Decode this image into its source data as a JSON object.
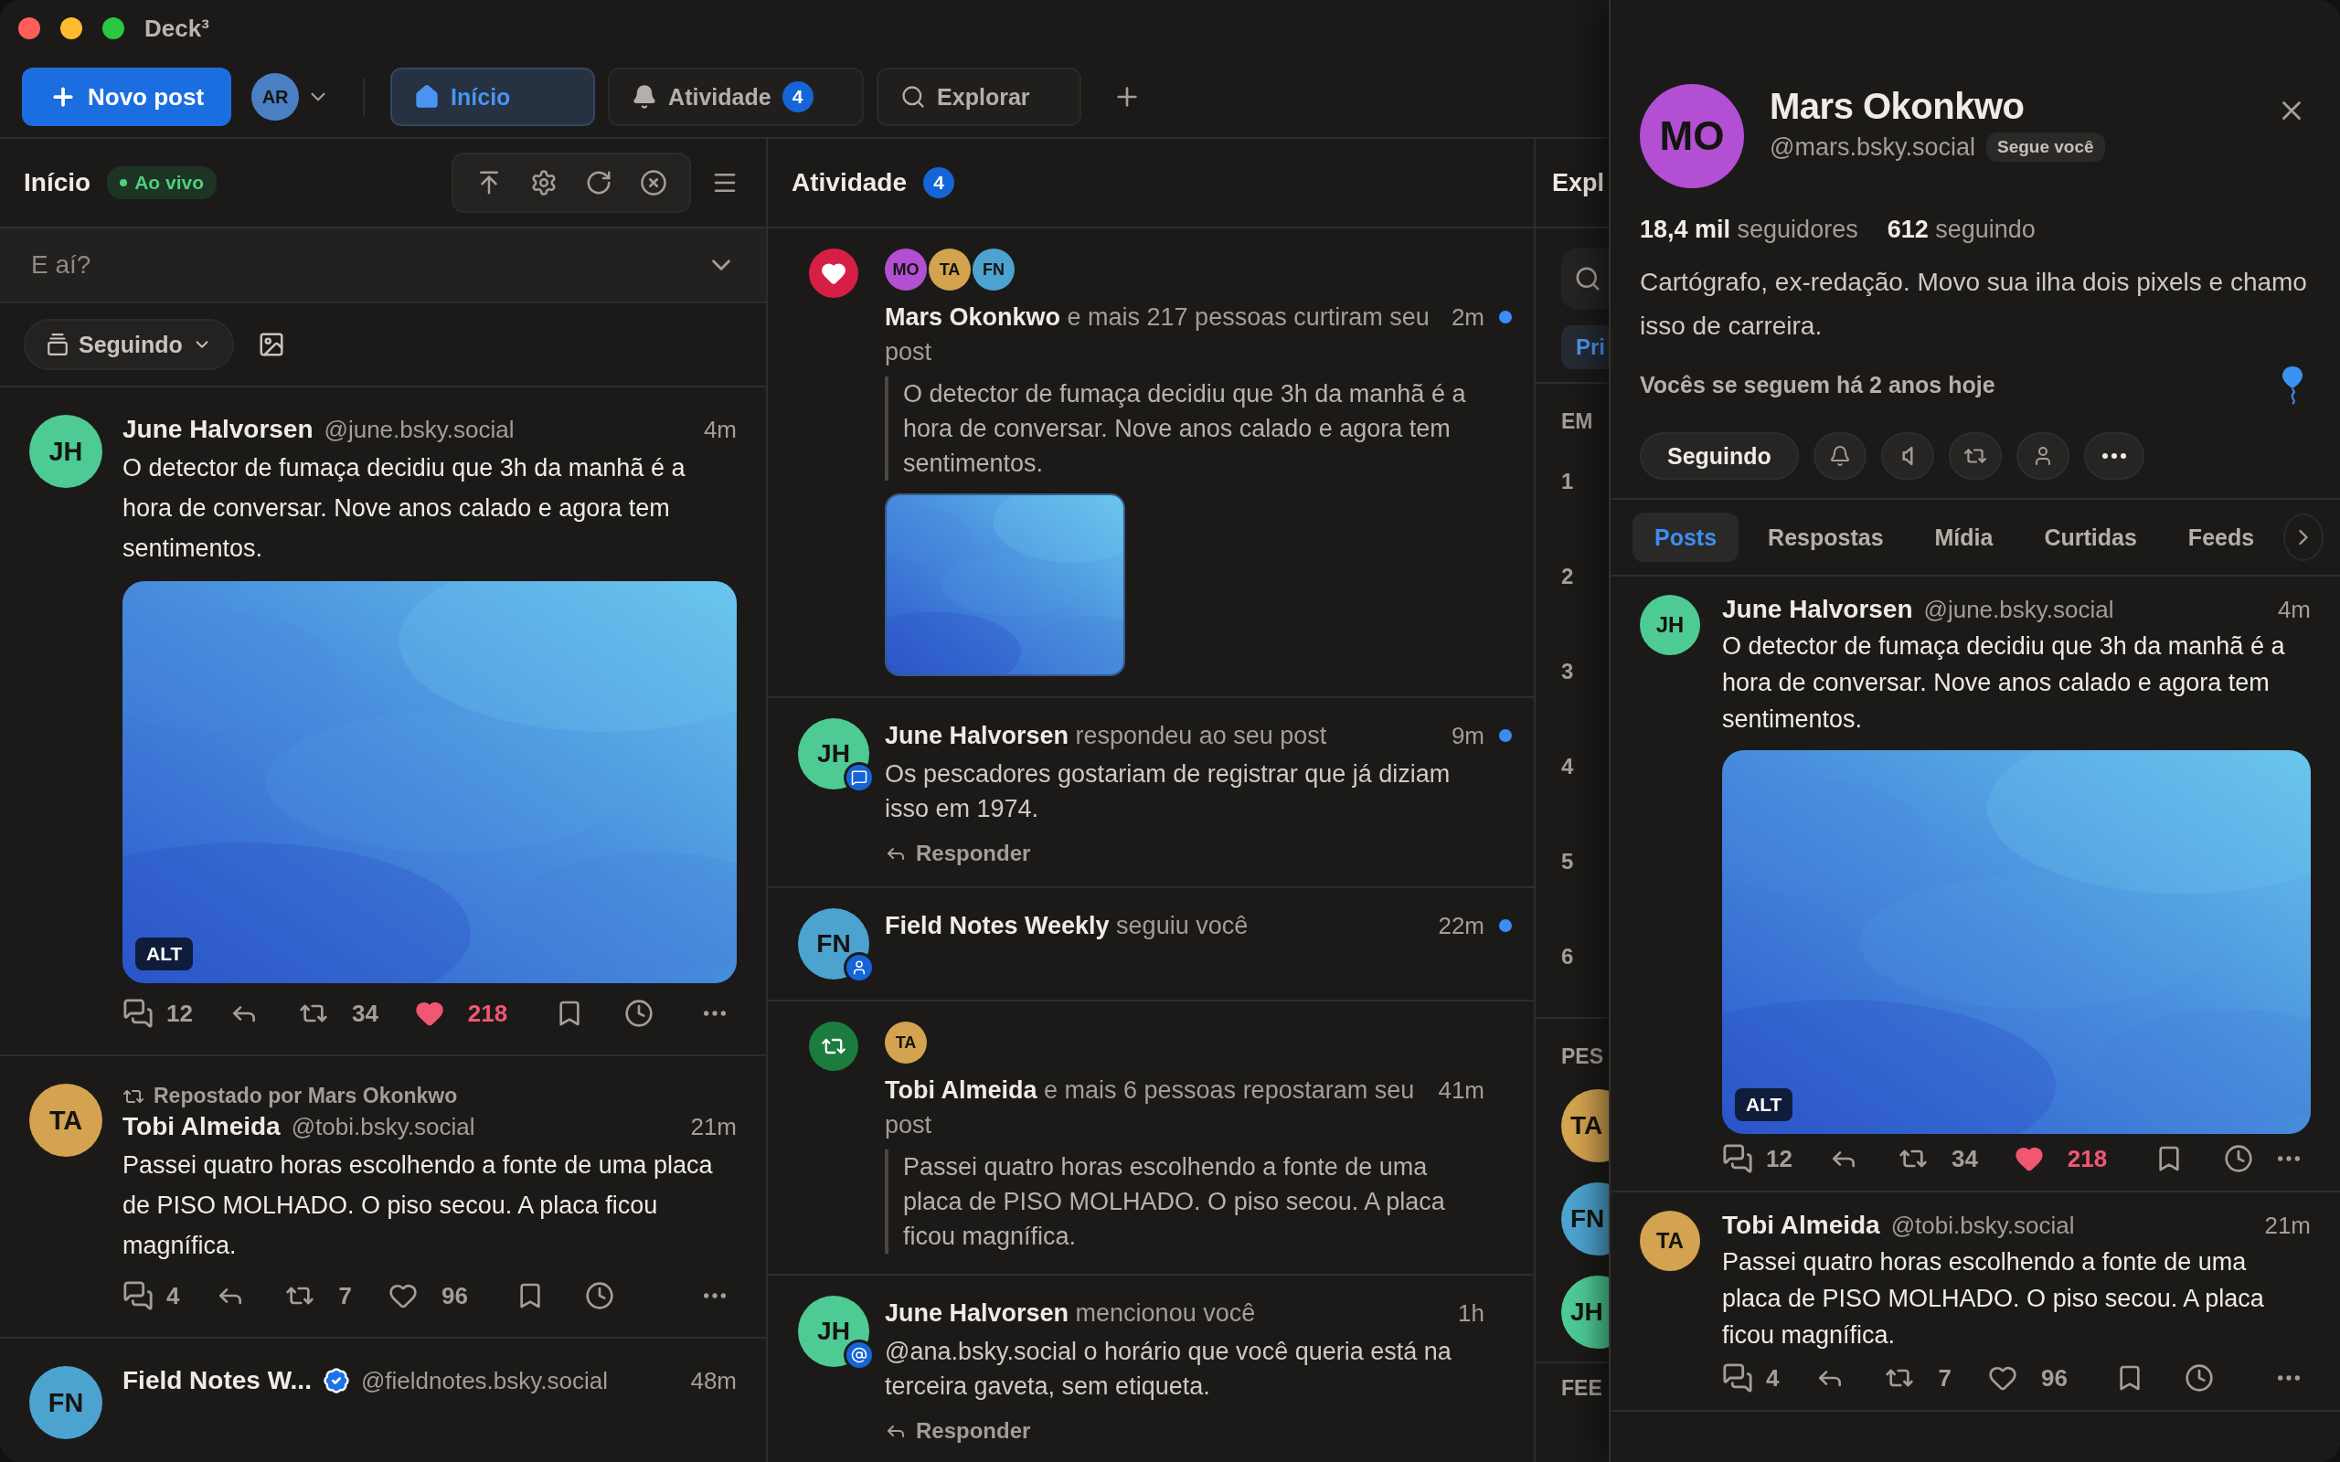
{
  "window": {
    "title": "Deck³"
  },
  "toolbar": {
    "new_post": "Novo post",
    "account": {
      "initials": "AR",
      "color": "#4a7fc4"
    },
    "tabs": [
      {
        "label": "Início",
        "selected": true
      },
      {
        "label": "Atividade",
        "badge": "4",
        "selected": false
      },
      {
        "label": "Explorar",
        "selected": false
      }
    ]
  },
  "home": {
    "title": "Início",
    "live_badge": "Ao vivo",
    "composer": {
      "placeholder": "E aí?"
    },
    "feed_filter": "Seguindo",
    "posts": [
      {
        "author": "June Halvorsen",
        "verified": false,
        "handle": "@june.bsky.social",
        "time": "4m",
        "avatar": {
          "initials": "JH",
          "color": "#4ecb94"
        },
        "text": "O detector de fumaça decidiu que 3h da manhã é a hora de conversar. Nove anos calado e agora tem sentimentos.",
        "image": {
          "kind": "picture",
          "alt_badge": "ALT"
        },
        "replies": "12",
        "reposts": "34",
        "likes": "218",
        "liked": true
      },
      {
        "reposted_by": "Repostado por Mars Okonkwo",
        "author": "Tobi Almeida",
        "verified": false,
        "handle": "@tobi.bsky.social",
        "time": "21m",
        "avatar": {
          "initials": "TA",
          "color": "#d3a34f"
        },
        "text": "Passei quatro horas escolhendo a fonte de uma placa de PISO MOLHADO. O piso secou. A placa ficou magnífica.",
        "replies": "4",
        "reposts": "7",
        "likes": "96",
        "liked": false
      },
      {
        "author": "Field Notes W...",
        "verified": true,
        "handle": "@fieldnotes.bsky.social",
        "time": "48m",
        "avatar": {
          "initials": "FN",
          "color": "#4ca3cf"
        }
      }
    ]
  },
  "activity": {
    "title": "Atividade",
    "badge": "4",
    "notifications": [
      {
        "kind": "like",
        "unread": true,
        "avatars": [
          {
            "initials": "MO",
            "color": "#b24fd2"
          },
          {
            "initials": "TA",
            "color": "#d3a34f"
          },
          {
            "initials": "FN",
            "color": "#4ca3cf"
          }
        ],
        "headline": "**Mars Okonkwo** e mais 217 pessoas curtiram seu post",
        "time": "2m",
        "quote": "O detector de fumaça decidiu que 3h da manhã é a hora de conversar. Nove anos calado e agora tem sentimentos."
      },
      {
        "kind": "reply",
        "unread": true,
        "avatar": {
          "initials": "JH",
          "color": "#4ecb94"
        },
        "headline": "**June Halvorsen** respondeu ao seu post",
        "time": "9m",
        "text": "Os pescadores gostariam de registrar que já diziam isso em 1974.",
        "reply_label": "Responder"
      },
      {
        "kind": "follow",
        "unread": true,
        "avatar": {
          "initials": "FN",
          "color": "#4ca3cf"
        },
        "headline": "**Field Notes Weekly** seguiu você",
        "time": "22m"
      },
      {
        "kind": "repost",
        "unread": false,
        "avatars": [
          {
            "initials": "TA",
            "color": "#d3a34f"
          }
        ],
        "headline": "**Tobi Almeida** e mais 6 pessoas repostaram seu post",
        "time": "41m",
        "quote": "Passei quatro horas escolhendo a fonte de uma placa de PISO MOLHADO. O piso secou. A placa ficou magnífica."
      },
      {
        "kind": "mention",
        "unread": false,
        "avatar": {
          "initials": "JH",
          "color": "#4ecb94"
        },
        "headline": "**June Halvorsen** mencionou você",
        "time": "1h",
        "text": "@ana.bsky.social o horário que você queria está na terceira gaveta, sem etiqueta.",
        "reply_label": "Responder"
      }
    ]
  },
  "explore": {
    "title": "Expl",
    "chip": "Pri",
    "trending_heading": "EM",
    "ranks": [
      "1",
      "2",
      "3",
      "4",
      "5",
      "6"
    ],
    "people_heading": "PES",
    "people": [
      {
        "initials": "TA",
        "color": "#d3a34f"
      },
      {
        "initials": "FN",
        "color": "#4ca3cf"
      },
      {
        "initials": "JH",
        "color": "#4ecb94"
      }
    ],
    "feeds_heading": "FEE"
  },
  "profile": {
    "avatar": {
      "initials": "MO",
      "color": "#b24fd2"
    },
    "name": "Mars Okonkwo",
    "handle": "@mars.bsky.social",
    "follows_you": "Segue você",
    "stats": [
      "**18,4 mil** seguidores",
      "**612** seguindo"
    ],
    "bio": "Cartógrafo, ex-redação. Movo sua ilha dois pixels e chamo isso de carreira.",
    "anniversary": "Vocês se seguem há 2 anos hoje",
    "follow_button": "Seguindo",
    "tabs": [
      {
        "label": "Posts",
        "selected": true
      },
      {
        "label": "Respostas",
        "selected": false
      },
      {
        "label": "Mídia",
        "selected": false
      },
      {
        "label": "Curtidas",
        "selected": false
      },
      {
        "label": "Feeds",
        "selected": false
      }
    ],
    "posts": [
      {
        "author": "June Halvorsen",
        "verified": false,
        "handle": "@june.bsky.social",
        "time": "4m",
        "avatar": {
          "initials": "JH",
          "color": "#4ecb94"
        },
        "text": "O detector de fumaça decidiu que 3h da manhã é a hora de conversar. Nove anos calado e agora tem sentimentos.",
        "image": {
          "kind": "picture",
          "alt_badge": "ALT"
        },
        "replies": "12",
        "reposts": "34",
        "likes": "218",
        "liked": true
      },
      {
        "author": "Tobi Almeida",
        "verified": false,
        "handle": "@tobi.bsky.social",
        "time": "21m",
        "avatar": {
          "initials": "TA",
          "color": "#d3a34f"
        },
        "text": "Passei quatro horas escolhendo a fonte de uma placa de PISO MOLHADO. O piso secou. A placa ficou magnífica.",
        "replies": "4",
        "reposts": "7",
        "likes": "96",
        "liked": false
      }
    ]
  }
}
